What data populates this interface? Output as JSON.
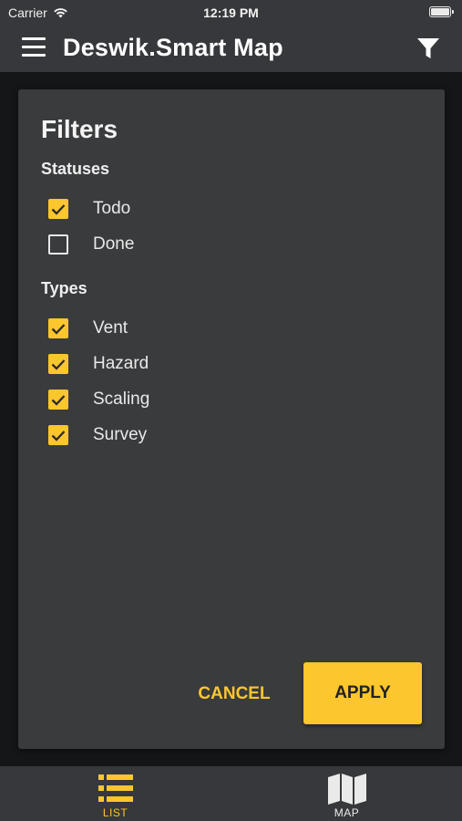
{
  "status_bar": {
    "carrier": "Carrier",
    "time": "12:19 PM"
  },
  "app_bar": {
    "title": "Deswik.Smart Map"
  },
  "filters": {
    "title": "Filters",
    "statuses": {
      "title": "Statuses",
      "options": [
        {
          "label": "Todo",
          "checked": true
        },
        {
          "label": "Done",
          "checked": false
        }
      ]
    },
    "types": {
      "title": "Types",
      "options": [
        {
          "label": "Vent",
          "checked": true
        },
        {
          "label": "Hazard",
          "checked": true
        },
        {
          "label": "Scaling",
          "checked": true
        },
        {
          "label": "Survey",
          "checked": true
        }
      ]
    },
    "cancel_label": "CANCEL",
    "apply_label": "APPLY"
  },
  "bottom_nav": {
    "items": [
      {
        "label": "LIST",
        "active": true
      },
      {
        "label": "MAP",
        "active": false
      }
    ]
  },
  "colors": {
    "accent": "#fcc62d",
    "bar_bg": "#37383b",
    "dialog_bg": "#3a3b3d",
    "backdrop": "#151617",
    "inactive_nav": "#eaeaea"
  },
  "icons": {
    "menu": "hamburger-icon",
    "filter": "funnel-icon",
    "wifi": "wifi-icon",
    "battery": "battery-icon",
    "list": "list-icon",
    "map": "folded-map-icon",
    "check": "checkmark-icon"
  }
}
